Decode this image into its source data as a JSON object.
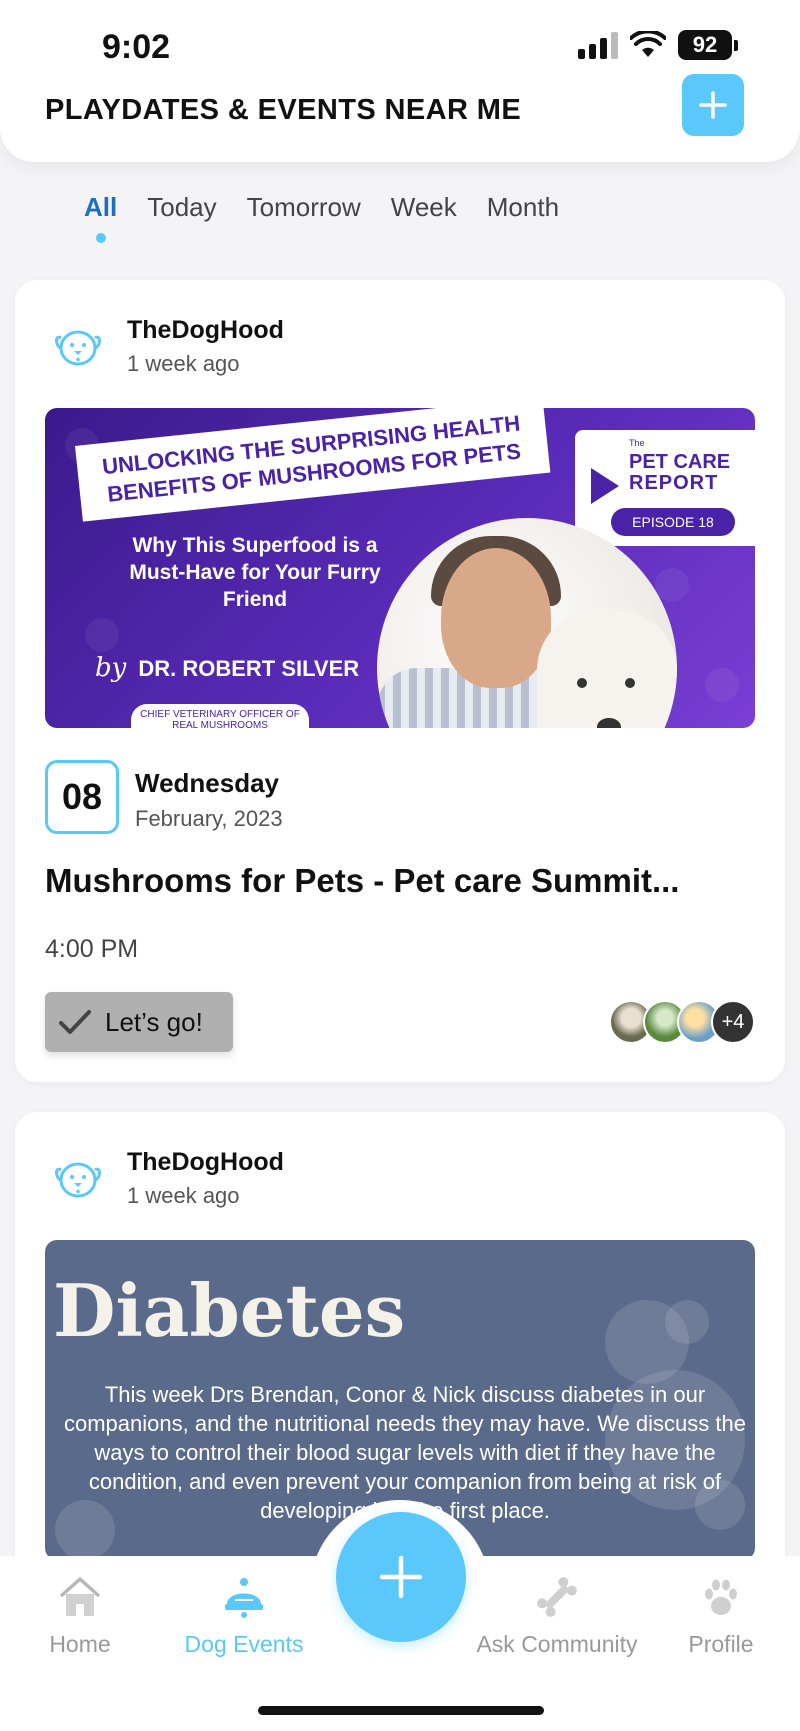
{
  "status_bar": {
    "time": "9:02",
    "battery": "92"
  },
  "header": {
    "title": "PLAYDATES & EVENTS NEAR ME"
  },
  "tabs": [
    {
      "label": "All",
      "active": true
    },
    {
      "label": "Today",
      "active": false
    },
    {
      "label": "Tomorrow",
      "active": false
    },
    {
      "label": "Week",
      "active": false
    },
    {
      "label": "Month",
      "active": false
    }
  ],
  "events": [
    {
      "author": "TheDogHood",
      "posted": "1 week ago",
      "banner": {
        "headline_line1": "UNLOCKING THE SURPRISING HEALTH",
        "headline_line2": "BENEFITS OF MUSHROOMS FOR PETS",
        "subheadline": "Why This Superfood is a Must-Have for Your Furry Friend",
        "by": "by",
        "author": "DR. ROBERT SILVER",
        "role": "CHIEF VETERINARY OFFICER OF REAL MUSHROOMS",
        "badge_the": "The",
        "badge_line1": "PET CARE",
        "badge_line2": "REPORT",
        "episode": "EPISODE 18"
      },
      "date_number": "08",
      "weekday": "Wednesday",
      "month_year": "February, 2023",
      "title": "Mushrooms for Pets - Pet care Summit...",
      "time": "4:00 PM",
      "cta": "Let’s go!",
      "attendees_more": "+4"
    },
    {
      "author": "TheDogHood",
      "posted": "1 week ago",
      "banner": {
        "title": "Diabetes",
        "text": "This week Drs Brendan, Conor & Nick discuss diabetes in our companions, and the nutritional needs they may have. We discuss the ways to control their blood sugar levels with diet if they have the condition, and even prevent your companion from being at risk of developing it in the first place."
      }
    }
  ],
  "bottom_nav": [
    {
      "label": "Home",
      "icon": "home-icon",
      "active": false
    },
    {
      "label": "Dog Events",
      "icon": "dog-events-icon",
      "active": true
    },
    {
      "label": "Ask Community",
      "icon": "bone-icon",
      "active": false
    },
    {
      "label": "Profile",
      "icon": "paw-icon",
      "active": false
    }
  ],
  "colors": {
    "accent": "#5ac8fa",
    "active_tab": "#1f6fc0",
    "button_gray": "#b0b0b0"
  }
}
